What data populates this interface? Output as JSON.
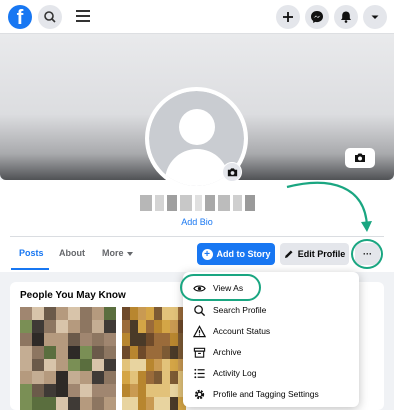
{
  "nav": {
    "logo_letter": "f",
    "icons": [
      "facebook-logo",
      "search-icon",
      "menu-icon",
      "plus-icon",
      "messenger-icon",
      "notifications-icon",
      "chevron-down-icon"
    ]
  },
  "profile": {
    "add_bio": "Add Bio"
  },
  "tabs": [
    {
      "label": "Posts",
      "active": true
    },
    {
      "label": "About",
      "active": false
    },
    {
      "label": "More",
      "active": false
    }
  ],
  "actions": {
    "add_story": "Add to Story",
    "edit_profile": "Edit Profile",
    "more": "···"
  },
  "pymk": {
    "title": "People You May Know"
  },
  "menu": {
    "items": [
      {
        "label": "View As",
        "icon": "eye-icon"
      },
      {
        "label": "Search Profile",
        "icon": "search-icon"
      },
      {
        "label": "Account Status",
        "icon": "warning-icon"
      },
      {
        "label": "Archive",
        "icon": "archive-icon"
      },
      {
        "label": "Activity Log",
        "icon": "list-icon"
      },
      {
        "label": "Profile and Tagging Settings",
        "icon": "gear-icon"
      }
    ]
  },
  "colors": {
    "brand": "#1877f2",
    "annotation": "#1aa681"
  }
}
